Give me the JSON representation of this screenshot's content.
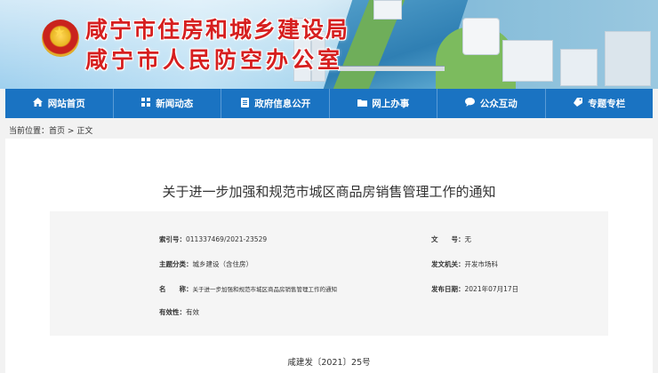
{
  "header": {
    "title_line1": "咸宁市住房和城乡建设局",
    "title_line2": "咸宁市人民防空办公室"
  },
  "nav": {
    "items": [
      {
        "label": "网站首页",
        "icon": "home-icon"
      },
      {
        "label": "新闻动态",
        "icon": "grid-icon"
      },
      {
        "label": "政府信息公开",
        "icon": "document-icon"
      },
      {
        "label": "网上办事",
        "icon": "folder-icon"
      },
      {
        "label": "公众互动",
        "icon": "chat-icon"
      },
      {
        "label": "专题专栏",
        "icon": "tag-icon"
      }
    ]
  },
  "breadcrumb": {
    "prefix": "当前位置：",
    "home": "首页",
    "separator": ">",
    "current": "正文"
  },
  "article": {
    "title": "关于进一步加强和规范市城区商品房销售管理工作的通知",
    "doc_number": "咸建发〔2021〕25号"
  },
  "meta": {
    "index_label": "索引号：",
    "index_value": "011337469/2021-23529",
    "docno_label": "文　　号：",
    "docno_value": "无",
    "category_label": "主题分类：",
    "category_value": "城乡建设（含住房）",
    "issuer_label": "发文机关：",
    "issuer_value": "开发市场科",
    "name_label": "名　　称：",
    "name_value": "关于进一步加强和规范市城区商品房销售管理工作的通知",
    "date_label": "发布日期：",
    "date_value": "2021年07月17日",
    "validity_label": "有效性：",
    "validity_value": "有效"
  },
  "colors": {
    "nav_blue": "#1a73c2",
    "title_red": "#d61f1f"
  }
}
